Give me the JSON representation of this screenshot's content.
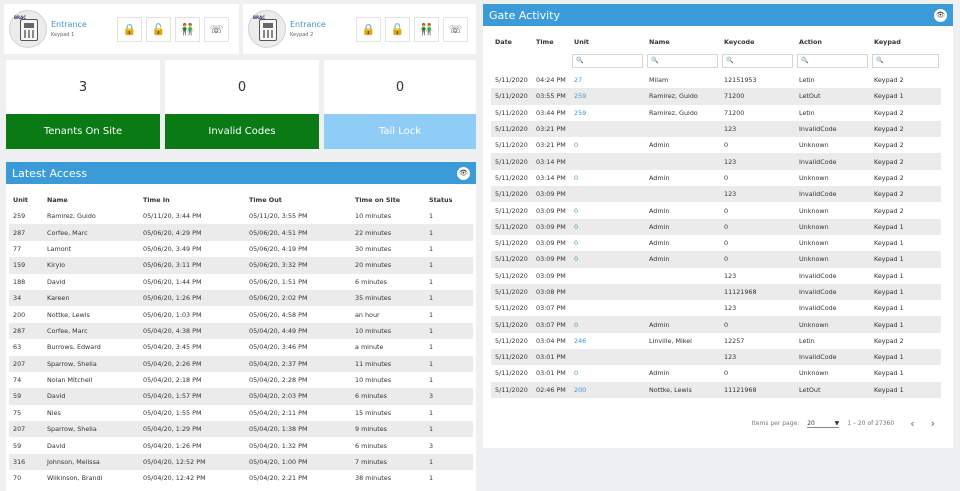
{
  "keypads": [
    {
      "name": "Entrance",
      "sub": "Keypad 1"
    },
    {
      "name": "Entrance",
      "sub": "Keypad 2"
    }
  ],
  "device_tag": "BRAC",
  "icons": {
    "lock": "🔒",
    "unlock": "🔓",
    "people": "👬",
    "keypad": "☏",
    "eye": "👁"
  },
  "stats": [
    {
      "value": "3",
      "label": "Tenants On Site",
      "color": "#0a7a14"
    },
    {
      "value": "0",
      "label": "Invalid Codes",
      "color": "#0a7a14"
    },
    {
      "value": "0",
      "label": "Tail Lock",
      "color": "#8fcdf7"
    }
  ],
  "latest_access": {
    "title": "Latest Access",
    "columns": [
      "Unit",
      "Name",
      "Time In",
      "Time Out",
      "Time on Site",
      "Status"
    ],
    "rows": [
      [
        "259",
        "Ramirez, Guido",
        "05/11/20, 3:44 PM",
        "05/11/20, 3:55 PM",
        "10 minutes",
        "1"
      ],
      [
        "287",
        "Corfee, Marc",
        "05/06/20, 4:29 PM",
        "05/06/20, 4:51 PM",
        "22 minutes",
        "1"
      ],
      [
        "77",
        "Lamont",
        "05/06/20, 3:49 PM",
        "05/06/20, 4:19 PM",
        "30 minutes",
        "1"
      ],
      [
        "159",
        "Kirylo",
        "05/06/20, 3:11 PM",
        "05/06/20, 3:32 PM",
        "20 minutes",
        "1"
      ],
      [
        "188",
        "David",
        "05/06/20, 1:44 PM",
        "05/06/20, 1:51 PM",
        "6 minutes",
        "1"
      ],
      [
        "34",
        "Kareen",
        "05/06/20, 1:26 PM",
        "05/06/20, 2:02 PM",
        "35 minutes",
        "1"
      ],
      [
        "200",
        "Nottke, Lewis",
        "05/06/20, 1:03 PM",
        "05/06/20, 4:58 PM",
        "an hour",
        "1"
      ],
      [
        "287",
        "Corfee, Marc",
        "05/04/20, 4:38 PM",
        "05/04/20, 4:49 PM",
        "10 minutes",
        "1"
      ],
      [
        "63",
        "Burrows, Edward",
        "05/04/20, 3:45 PM",
        "05/04/20, 3:46 PM",
        "a minute",
        "1"
      ],
      [
        "207",
        "Sparrow, Shelia",
        "05/04/20, 2:26 PM",
        "05/04/20, 2:37 PM",
        "11 minutes",
        "1"
      ],
      [
        "74",
        "Nolan Mitchell",
        "05/04/20, 2:18 PM",
        "05/04/20, 2:28 PM",
        "10 minutes",
        "1"
      ],
      [
        "59",
        "David",
        "05/04/20, 1:57 PM",
        "05/04/20, 2:03 PM",
        "6 minutes",
        "3"
      ],
      [
        "75",
        "Nies",
        "05/04/20, 1:55 PM",
        "05/04/20, 2:11 PM",
        "15 minutes",
        "1"
      ],
      [
        "207",
        "Sparrow, Shelia",
        "05/04/20, 1:29 PM",
        "05/04/20, 1:38 PM",
        "9 minutes",
        "1"
      ],
      [
        "59",
        "David",
        "05/04/20, 1:26 PM",
        "05/04/20, 1:32 PM",
        "6 minutes",
        "3"
      ],
      [
        "316",
        "Johnson, Melissa",
        "05/04/20, 12:52 PM",
        "05/04/20, 1:00 PM",
        "7 minutes",
        "1"
      ],
      [
        "70",
        "Wilkinson, Brandi",
        "05/04/20, 12:42 PM",
        "05/04/20, 2:21 PM",
        "38 minutes",
        "1"
      ]
    ]
  },
  "gate_activity": {
    "title": "Gate Activity",
    "columns": [
      "Date",
      "Time",
      "Unit",
      "Name",
      "Keycode",
      "Action",
      "Keypad"
    ],
    "filter_icon": "🔍",
    "rows": [
      [
        "5/11/2020",
        "04:24 PM",
        "27",
        "Milam",
        "12151953",
        "Letin",
        "Keypad 2"
      ],
      [
        "5/11/2020",
        "03:55 PM",
        "259",
        "Ramirez, Guido",
        "71200",
        "LetOut",
        "Keypad 1"
      ],
      [
        "5/11/2020",
        "03:44 PM",
        "259",
        "Ramirez, Guido",
        "71200",
        "Letin",
        "Keypad 2"
      ],
      [
        "5/11/2020",
        "03:21 PM",
        "",
        "",
        "123",
        "InvalidCode",
        "Keypad 2"
      ],
      [
        "5/11/2020",
        "03:21 PM",
        "0",
        "Admin",
        "0",
        "Unknown",
        "Keypad 2"
      ],
      [
        "5/11/2020",
        "03:14 PM",
        "",
        "",
        "123",
        "InvalidCode",
        "Keypad 2"
      ],
      [
        "5/11/2020",
        "03:14 PM",
        "0",
        "Admin",
        "0",
        "Unknown",
        "Keypad 2"
      ],
      [
        "5/11/2020",
        "03:09 PM",
        "",
        "",
        "123",
        "InvalidCode",
        "Keypad 2"
      ],
      [
        "5/11/2020",
        "03:09 PM",
        "0",
        "Admin",
        "0",
        "Unknown",
        "Keypad 2"
      ],
      [
        "5/11/2020",
        "03:09 PM",
        "0",
        "Admin",
        "0",
        "Unknown",
        "Keypad 1"
      ],
      [
        "5/11/2020",
        "03:09 PM",
        "0",
        "Admin",
        "0",
        "Unknown",
        "Keypad 1"
      ],
      [
        "5/11/2020",
        "03:09 PM",
        "0",
        "Admin",
        "0",
        "Unknown",
        "Keypad 1"
      ],
      [
        "5/11/2020",
        "03:09 PM",
        "",
        "",
        "123",
        "InvalidCode",
        "Keypad 1"
      ],
      [
        "5/11/2020",
        "03:08 PM",
        "",
        "",
        "11121968",
        "InvalidCode",
        "Keypad 1"
      ],
      [
        "5/11/2020",
        "03:07 PM",
        "",
        "",
        "123",
        "InvalidCode",
        "Keypad 1"
      ],
      [
        "5/11/2020",
        "03:07 PM",
        "0",
        "Admin",
        "0",
        "Unknown",
        "Keypad 1"
      ],
      [
        "5/11/2020",
        "03:04 PM",
        "246",
        "Linville, Mikel",
        "12257",
        "Letin",
        "Keypad 2"
      ],
      [
        "5/11/2020",
        "03:01 PM",
        "",
        "",
        "123",
        "InvalidCode",
        "Keypad 1"
      ],
      [
        "5/11/2020",
        "03:01 PM",
        "0",
        "Admin",
        "0",
        "Unknown",
        "Keypad 1"
      ],
      [
        "5/11/2020",
        "02:46 PM",
        "200",
        "Nottke, Lewis",
        "11121968",
        "LetOut",
        "Keypad 1"
      ]
    ],
    "pager": {
      "label": "Items per page:",
      "size": "20",
      "range": "1 – 20 of 27360",
      "prev": "‹",
      "next": "›",
      "dropdown": "▼"
    }
  }
}
